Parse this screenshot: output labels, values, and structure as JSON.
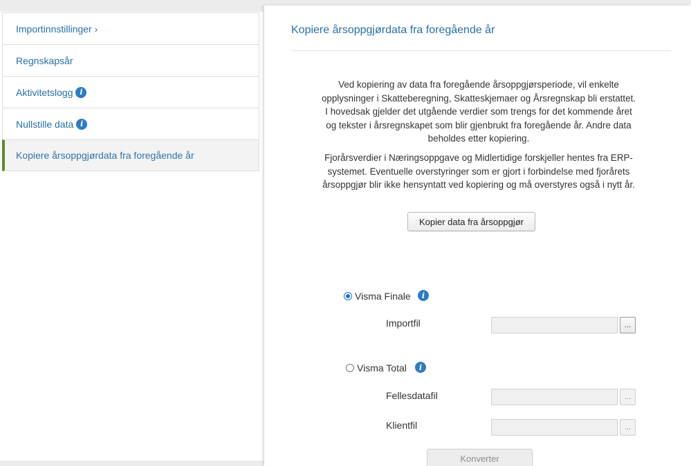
{
  "sidebar": {
    "items": [
      {
        "label": "Importinnstillinger ›",
        "info": false,
        "active": false
      },
      {
        "label": "Regnskapsår",
        "info": false,
        "active": false
      },
      {
        "label": "Aktivitetslogg",
        "info": true,
        "active": false
      },
      {
        "label": "Nullstille data",
        "info": true,
        "active": false
      },
      {
        "label": "Kopiere årsoppgjørdata fra foregående år",
        "info": false,
        "active": true
      }
    ]
  },
  "panel": {
    "title": "Kopiere årsoppgjørdata fra foregående år",
    "description_1": "Ved kopiering av data fra foregående årsoppgjørsperiode, vil enkelte opplysninger i Skatteberegning, Skatteskjemaer og Årsregnskap bli erstattet. I hovedsak gjelder det utgående verdier som trengs for det kommende året og tekster i årsregnskapet som blir gjenbrukt fra foregående år. Andre data beholdes etter kopiering.",
    "description_2": "Fjorårsverdier i Næringsoppgave og Midlertidige forskjeller hentes fra ERP-systemet. Eventuelle overstyringer som er gjort i forbindelse med fjorårets årsoppgjør blir ikke hensyntatt ved kopiering og må overstyres også i nytt år.",
    "copy_button": "Kopier data fra årsoppgjør",
    "visma_finale": {
      "label": "Visma Finale",
      "selected": true,
      "import_file_label": "Importfil",
      "import_file_value": "",
      "browse": "..."
    },
    "visma_total": {
      "label": "Visma Total",
      "selected": false,
      "shared_file_label": "Fellesdatafil",
      "shared_file_value": "",
      "client_file_label": "Klientfil",
      "client_file_value": "",
      "browse": "..."
    },
    "convert_button": "Konverter",
    "info_glyph": "i",
    "colors": {
      "link": "#2a6fa7",
      "active_marker": "#5e8e28",
      "info_icon": "#2d7bc2"
    }
  }
}
